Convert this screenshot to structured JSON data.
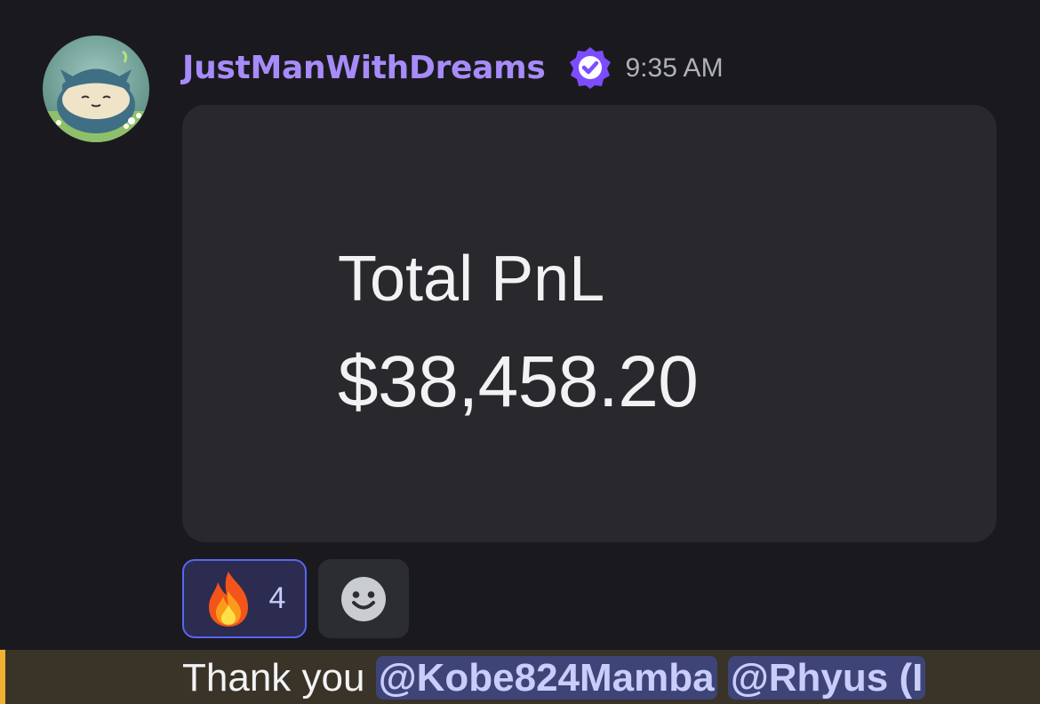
{
  "message": {
    "author": "JustManWithDreams",
    "timestamp": "9:35 AM",
    "avatar_icon": "snorlax-avatar-icon",
    "badge_icon": "verified-badge-icon",
    "attachment": {
      "label": "Total PnL",
      "value": "$38,458.20"
    },
    "reactions": [
      {
        "emoji": "fire-emoji-icon",
        "count": "4"
      }
    ],
    "add_reaction_icon": "smiley-face-icon"
  },
  "next_message": {
    "text": "Thank you",
    "mentions": [
      "@Kobe824Mamba",
      "@Rhyus (I"
    ]
  },
  "colors": {
    "username": "#a78bfa",
    "background": "#1a1a1e",
    "attachment_bg": "#28282d",
    "mention_bg": "#3e4478",
    "highlight_bar": "#f0b232",
    "reaction_border": "#5865f2"
  }
}
